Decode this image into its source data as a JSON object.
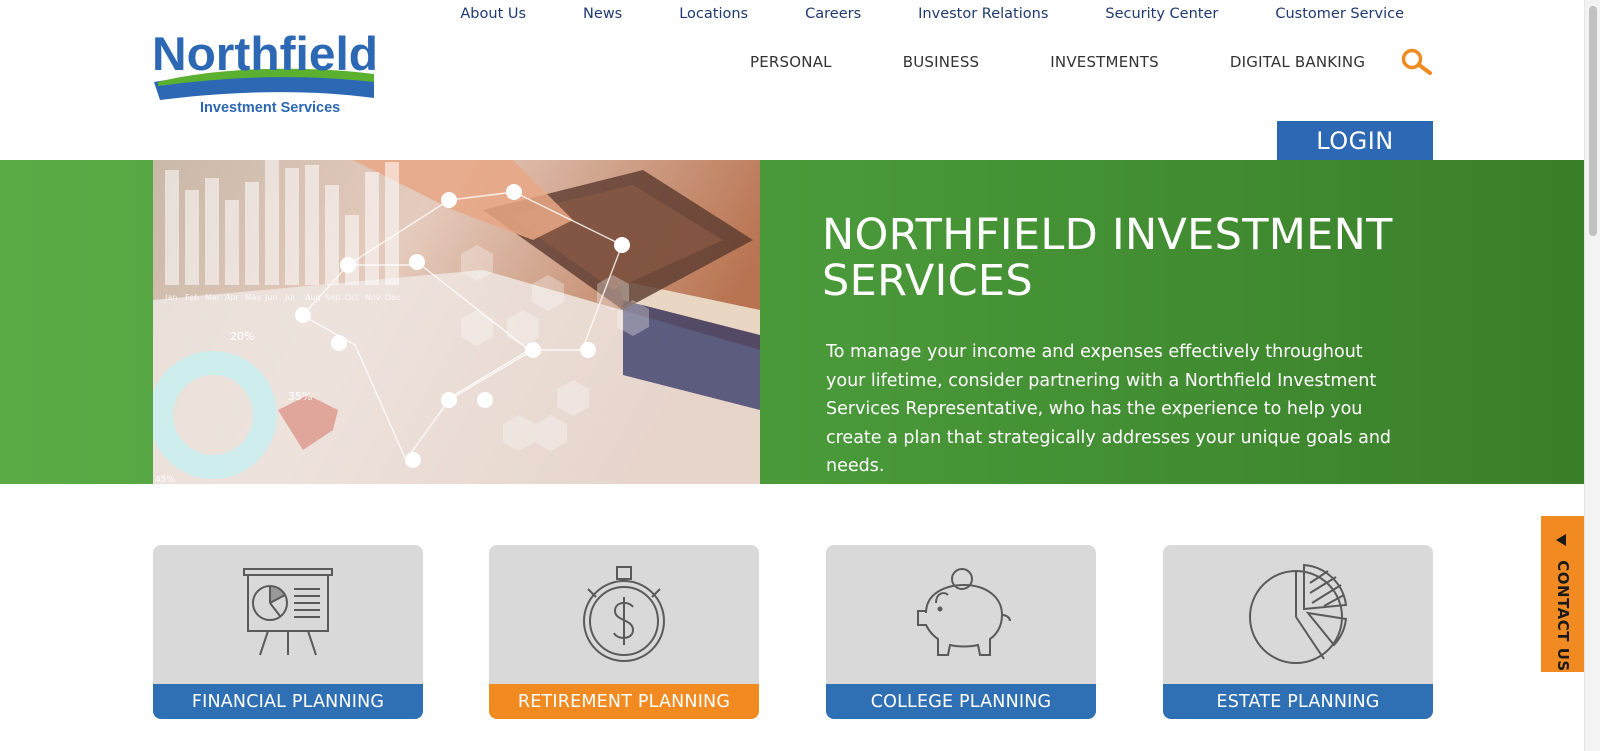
{
  "brand": {
    "name": "Northfield",
    "tagline": "Investment Services",
    "colors": {
      "blue": "#2c68b4",
      "green": "#5aab46",
      "orange": "#f28a22"
    }
  },
  "util_nav": [
    "About Us",
    "News",
    "Locations",
    "Careers",
    "Investor Relations",
    "Security Center",
    "Customer Service"
  ],
  "main_nav": [
    "PERSONAL",
    "BUSINESS",
    "INVESTMENTS",
    "DIGITAL BANKING"
  ],
  "search": {
    "icon": "search-icon"
  },
  "login": {
    "label": "LOGIN"
  },
  "hero": {
    "title": "NORTHFIELD INVESTMENT SERVICES",
    "text": "To manage your income and expenses effectively throughout your lifetime, consider partnering with a Northfield Investment Services Representative, who has the experience to help you create a plan that strategically addresses your unique goals and needs.",
    "image": {
      "months": [
        "Jan",
        "Feb",
        "Mar",
        "Apr",
        "May",
        "Jun",
        "Jul",
        "Aug",
        "Sep",
        "Oct",
        "Nov",
        "Dec"
      ],
      "pct_a": "20%",
      "pct_b": "35%",
      "pct_c": "45%"
    }
  },
  "cards": [
    {
      "label": "FINANCIAL PLANNING",
      "icon": "presentation-chart-icon",
      "color": "#2f6fb3"
    },
    {
      "label": "RETIREMENT PLANNING",
      "icon": "stopwatch-dollar-icon",
      "color": "#f28a22"
    },
    {
      "label": "COLLEGE PLANNING",
      "icon": "piggy-bank-icon",
      "color": "#2f6fb3"
    },
    {
      "label": "ESTATE PLANNING",
      "icon": "pie-chart-icon",
      "color": "#2f6fb3"
    }
  ],
  "contact": {
    "label": "CONTACT US",
    "icon": "triangle-left-icon"
  }
}
